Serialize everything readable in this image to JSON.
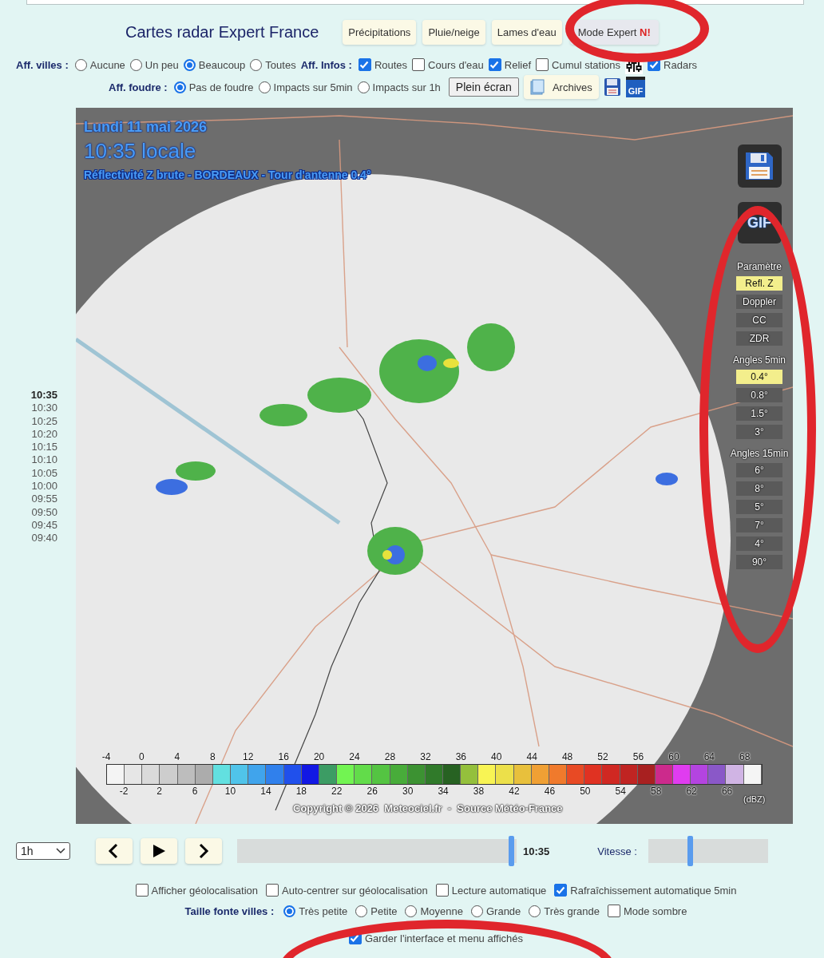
{
  "header": {
    "title": "Cartes radar Expert France",
    "tabs": [
      {
        "label": "Précipitations",
        "selected": false
      },
      {
        "label": "Pluie/neige",
        "selected": false
      },
      {
        "label": "Lames d'eau",
        "selected": false
      },
      {
        "label": "Mode Expert **N!**",
        "selected": true
      }
    ]
  },
  "options_row_1": [
    {
      "kind": "label",
      "text": "Aff. villes :"
    },
    {
      "kind": "radio",
      "label": "Aucune",
      "selected": false
    },
    {
      "kind": "radio",
      "label": "Un peu",
      "selected": false
    },
    {
      "kind": "radio",
      "label": "Beaucoup",
      "selected": true
    },
    {
      "kind": "radio",
      "label": "Toutes",
      "selected": false
    },
    {
      "kind": "label",
      "text": "Aff. Infos :"
    },
    {
      "kind": "checkbox",
      "label": "Routes",
      "checked": true
    },
    {
      "kind": "checkbox",
      "label": "Cours d'eau",
      "checked": false
    },
    {
      "kind": "checkbox",
      "label": "Relief",
      "checked": true
    },
    {
      "kind": "checkbox",
      "label": "Cumul stations",
      "checked": false
    },
    {
      "kind": "sliders_icon"
    },
    {
      "kind": "checkbox",
      "label": "Radars",
      "checked": true
    }
  ],
  "options_row_2": [
    {
      "kind": "label",
      "text": "Aff. foudre :"
    },
    {
      "kind": "radio",
      "label": "Pas de foudre",
      "selected": true
    },
    {
      "kind": "radio",
      "label": "Impacts sur 5min",
      "selected": false
    },
    {
      "kind": "radio",
      "label": "Impacts sur 1h",
      "selected": false
    },
    {
      "kind": "button",
      "label": "Plein écran"
    },
    {
      "kind": "archive_button",
      "label": "Archives"
    },
    {
      "kind": "save_icon"
    },
    {
      "kind": "gif_icon",
      "label": "GIF"
    }
  ],
  "times": [
    {
      "label": "10:35",
      "selected": true
    },
    {
      "label": "10:30",
      "selected": false
    },
    {
      "label": "10:25",
      "selected": false
    },
    {
      "label": "10:20",
      "selected": false
    },
    {
      "label": "10:15",
      "selected": false
    },
    {
      "label": "10:10",
      "selected": false
    },
    {
      "label": "10:05",
      "selected": false
    },
    {
      "label": "10:00",
      "selected": false
    },
    {
      "label": "09:55",
      "selected": false
    },
    {
      "label": "09:50",
      "selected": false
    },
    {
      "label": "09:45",
      "selected": false
    },
    {
      "label": "09:40",
      "selected": false
    }
  ],
  "map": {
    "date": "Lundi 11 mai 2026",
    "time": "10:35 locale",
    "product": "Réflectivité Z brute - BORDEAUX - Tour d'antenne 0.4°",
    "gif_label": "GIF",
    "panel": [
      {
        "kind": "heading",
        "label": "Paramètre"
      },
      {
        "kind": "button",
        "label": "Refl. Z",
        "selected": true
      },
      {
        "kind": "button",
        "label": "Doppler",
        "selected": false
      },
      {
        "kind": "button",
        "label": "CC",
        "selected": false
      },
      {
        "kind": "button",
        "label": "ZDR",
        "selected": false
      },
      {
        "kind": "heading",
        "label": "Angles 5min"
      },
      {
        "kind": "button",
        "label": "0.4°",
        "selected": true
      },
      {
        "kind": "button",
        "label": "0.8°",
        "selected": false
      },
      {
        "kind": "button",
        "label": "1.5°",
        "selected": false
      },
      {
        "kind": "button",
        "label": "3°",
        "selected": false
      },
      {
        "kind": "heading",
        "label": "Angles 15min"
      },
      {
        "kind": "button",
        "label": "6°",
        "selected": false
      },
      {
        "kind": "button",
        "label": "8°",
        "selected": false
      },
      {
        "kind": "button",
        "label": "5°",
        "selected": false
      },
      {
        "kind": "button",
        "label": "7°",
        "selected": false
      },
      {
        "kind": "button",
        "label": "4°",
        "selected": false
      },
      {
        "kind": "button",
        "label": "90°",
        "selected": false
      }
    ],
    "legend": {
      "unit": "(dBZ)",
      "ticks": [
        "-4",
        "-2",
        "0",
        "2",
        "4",
        "6",
        "8",
        "10",
        "12",
        "14",
        "16",
        "18",
        "20",
        "22",
        "24",
        "26",
        "28",
        "30",
        "32",
        "34",
        "36",
        "38",
        "40",
        "42",
        "44",
        "46",
        "48",
        "50",
        "52",
        "54",
        "56",
        "58",
        "60",
        "62",
        "64",
        "66",
        "68"
      ],
      "cells": [
        {
          "color": "#f4f4f4"
        },
        {
          "color": "#e6e6e6"
        },
        {
          "color": "#dadada"
        },
        {
          "color": "#cdcdcd"
        },
        {
          "color": "#bdbdbd"
        },
        {
          "color": "#acacac"
        },
        {
          "color": "#62e0e0"
        },
        {
          "color": "#50c4ea"
        },
        {
          "color": "#40a4ec"
        },
        {
          "color": "#3080ec"
        },
        {
          "color": "#2050ec"
        },
        {
          "color": "#1218e4"
        },
        {
          "color": "#3c9c64"
        },
        {
          "color": "#72f452"
        },
        {
          "color": "#62dc4a"
        },
        {
          "color": "#54c442"
        },
        {
          "color": "#48ac3a"
        },
        {
          "color": "#3c9232"
        },
        {
          "color": "#307a2a"
        },
        {
          "color": "#276222"
        },
        {
          "color": "#94c03c"
        },
        {
          "color": "#f8f454"
        },
        {
          "color": "#ece04a"
        },
        {
          "color": "#e8c03c"
        },
        {
          "color": "#f0a034"
        },
        {
          "color": "#f07a2c"
        },
        {
          "color": "#e84a24"
        },
        {
          "color": "#e03222"
        },
        {
          "color": "#d02822"
        },
        {
          "color": "#c02422"
        },
        {
          "color": "#a82020"
        },
        {
          "color": "#cc2a8c"
        },
        {
          "color": "#e03cf0"
        },
        {
          "color": "#b444e0"
        },
        {
          "color": "#8a58c8"
        },
        {
          "color": "#d0b4e4"
        },
        {
          "color": "#f5f5f5"
        }
      ]
    },
    "copyright": "Copyright © 2026  Meteociel.fr  -  Source Météo-France"
  },
  "player": {
    "range": "1h",
    "timeline": {
      "level": 0.98,
      "reading": "10:35"
    },
    "speed": {
      "label": "Vitesse :",
      "level": 0.35
    }
  },
  "settings": [
    [
      {
        "kind": "checkbox",
        "label": "Afficher géolocalisation",
        "checked": false
      },
      {
        "kind": "checkbox",
        "label": "Auto-centrer sur géolocalisation",
        "checked": false
      },
      {
        "kind": "checkbox",
        "label": "Lecture automatique",
        "checked": false
      },
      {
        "kind": "checkbox",
        "label": "Rafraîchissement automatique 5min",
        "checked": true
      }
    ],
    [
      {
        "kind": "label",
        "text": "Taille fonte villes :"
      },
      {
        "kind": "radio",
        "label": "Très petite",
        "selected": true
      },
      {
        "kind": "radio",
        "label": "Petite",
        "selected": false
      },
      {
        "kind": "radio",
        "label": "Moyenne",
        "selected": false
      },
      {
        "kind": "radio",
        "label": "Grande",
        "selected": false
      },
      {
        "kind": "radio",
        "label": "Très grande",
        "selected": false
      },
      {
        "kind": "checkbox",
        "label": "Mode sombre",
        "checked": false
      }
    ],
    [
      {
        "kind": "checkbox",
        "label": "Garder l'interface et menu affichés",
        "checked": true
      }
    ]
  ],
  "annotations": [
    {
      "kind": "ellipse"
    },
    {
      "kind": "ellipse"
    },
    {
      "kind": "ellipse"
    }
  ]
}
